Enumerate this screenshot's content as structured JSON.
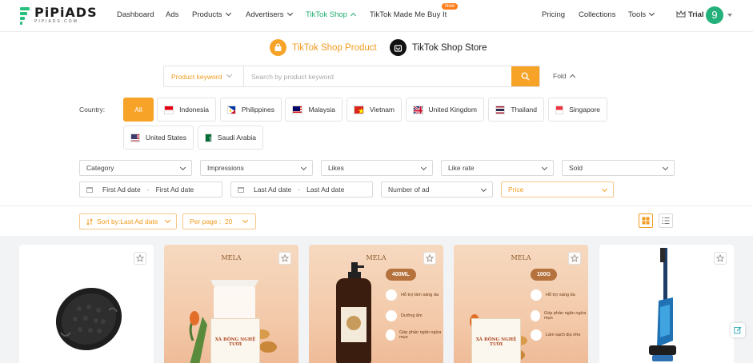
{
  "logo": {
    "name": "PiPiADS",
    "sub": "PIPIADS.COM"
  },
  "nav": {
    "items": [
      {
        "label": "Dashboard"
      },
      {
        "label": "Ads"
      },
      {
        "label": "Products"
      },
      {
        "label": "Advertisers"
      },
      {
        "label": "TikTok Shop"
      },
      {
        "label": "TikTok Made Me Buy It"
      },
      {
        "label": "Pricing"
      },
      {
        "label": "Collections"
      },
      {
        "label": "Tools"
      }
    ],
    "new_badge": "New",
    "trial_label": "Trial",
    "avatar_letter": "9"
  },
  "modes": {
    "product": "TikTok Shop Product",
    "store": "TikTok Shop Store"
  },
  "search": {
    "type_label": "Product keyword",
    "placeholder": "Search by product keyword",
    "fold_label": "Fold"
  },
  "country": {
    "label": "Country:",
    "options": [
      "All",
      "Indonesia",
      "Philippines",
      "Malaysia",
      "Vietnam",
      "United Kingdom",
      "Thailand",
      "Singapore",
      "United States",
      "Saudi Arabia"
    ]
  },
  "filters": {
    "category": "Category",
    "impressions": "Impressions",
    "likes": "Likes",
    "like_rate": "Like rate",
    "sold": "Sold",
    "first_ad_from": "First Ad date",
    "first_ad_to": "First Ad date",
    "last_ad_from": "Last Ad date",
    "last_ad_to": "Last Ad date",
    "date_sep": "-",
    "number_of_ad": "Number of ad",
    "price": "Price"
  },
  "sort": {
    "sort_label": "Sort by:Last Ad date",
    "per_page_label": "Per page :  20"
  },
  "cards": {
    "brand": "MELA",
    "bottle_size": "400ML",
    "soap_weight": "100G",
    "soap_name": "XÀ BÔNG NGHỆ TƯƠI",
    "benefits_2": [
      "Hỗ trợ làm sáng da",
      "Dưỡng ẩm",
      "Góp phần ngăn ngừa mụn"
    ],
    "benefits_3": [
      "Hỗ trợ sáng da",
      "Góp phần ngăn ngừa mụn",
      "Làm sạch dịu nhẹ"
    ]
  },
  "colors": {
    "accent": "#f7a327",
    "brand_green": "#1fae6e"
  }
}
